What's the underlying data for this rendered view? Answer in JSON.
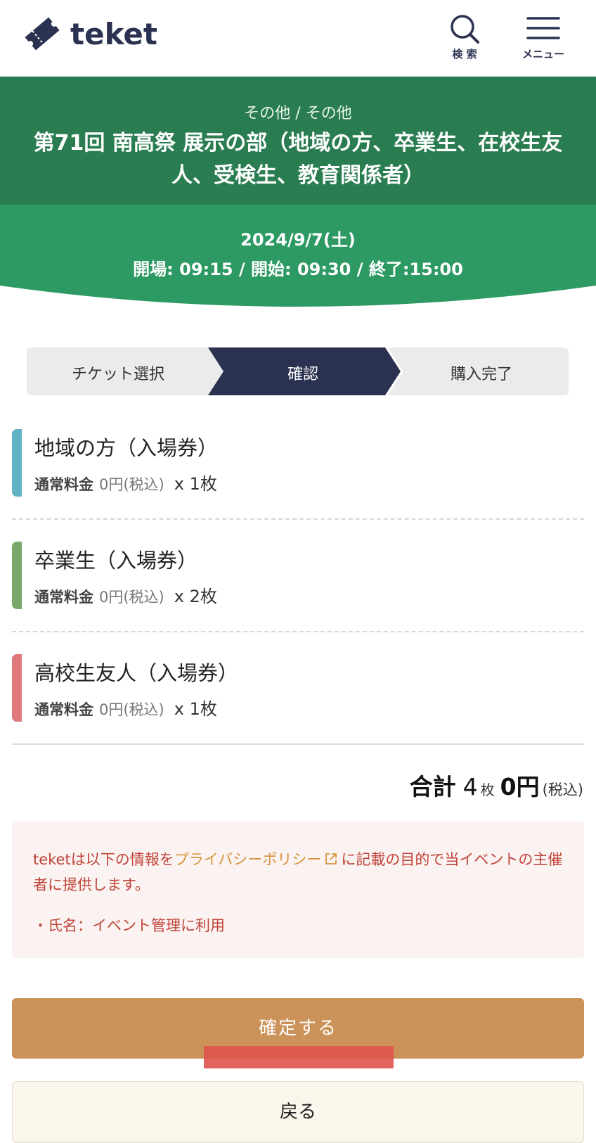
{
  "header": {
    "logo_text": "teket",
    "search_label": "検 索",
    "menu_label": "メニュー"
  },
  "event": {
    "category": "その他 / その他",
    "title": "第71回 南高祭 展示の部（地域の方、卒業生、在校生友人、受検生、教育関係者）",
    "date": "2024/9/7(土)",
    "times": "開場: 09:15 / 開始: 09:30 / 終了:15:00"
  },
  "steps": {
    "items": [
      {
        "label": "チケット選択",
        "active": false
      },
      {
        "label": "確認",
        "active": true
      },
      {
        "label": "購入完了",
        "active": false
      }
    ]
  },
  "tickets": [
    {
      "name": "地域の方（入場券）",
      "price_type": "通常料金",
      "price": "0円(税込)",
      "qty": "x 1枚",
      "color": "#5fb3c4"
    },
    {
      "name": "卒業生（入場券）",
      "price_type": "通常料金",
      "price": "0円(税込)",
      "qty": "x 2枚",
      "color": "#7aa86a"
    },
    {
      "name": "高校生友人（入場券）",
      "price_type": "通常料金",
      "price": "0円(税込)",
      "qty": "x 1枚",
      "color": "#e07a7a"
    }
  ],
  "total": {
    "label": "合計",
    "count": "4",
    "count_unit": "枚",
    "amount": "0円",
    "tax": "(税込)"
  },
  "notice": {
    "prefix": "teketは以下の情報を",
    "link": "プライバシーポリシー",
    "suffix": "に記載の目的で当イベントの主催者に提供します。",
    "item": "・氏名：イベント管理に利用"
  },
  "buttons": {
    "confirm": "確定する",
    "back": "戻る"
  },
  "colors": {
    "header_green": "#2a7d50",
    "date_green": "#2e9a63",
    "step_active": "#2b3150",
    "confirm_button": "#cb935a",
    "notice_text": "#c0443a"
  }
}
